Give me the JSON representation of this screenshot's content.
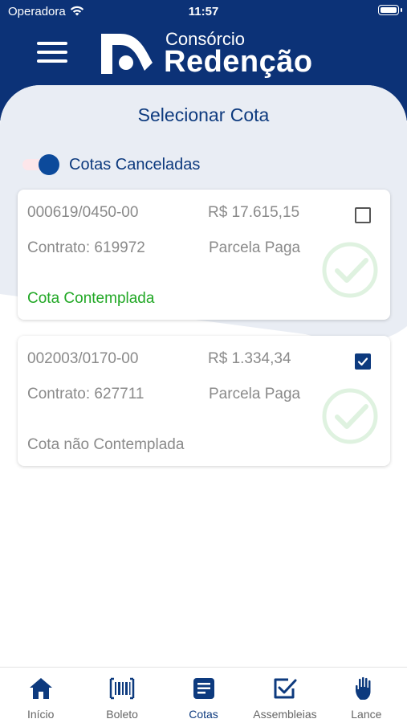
{
  "status_bar": {
    "carrier": "Operadora",
    "time": "11:57"
  },
  "logo": {
    "line1": "Consórcio",
    "line2": "Redenção"
  },
  "page": {
    "title": "Selecionar Cota"
  },
  "filter": {
    "label": "Cotas Canceladas",
    "enabled": true
  },
  "cards": [
    {
      "code": "000619/0450-00",
      "value": "R$ 17.615,15",
      "contract": "Contrato: 619972",
      "parcel_status": "Parcela Paga",
      "quota_status": "Cota Contemplada",
      "selected": false
    },
    {
      "code": "002003/0170-00",
      "value": "R$ 1.334,34",
      "contract": "Contrato: 627711",
      "parcel_status": "Parcela Paga",
      "quota_status": "Cota não Contemplada",
      "selected": true
    }
  ],
  "bottom_nav": [
    {
      "label": "Início",
      "icon": "home-icon"
    },
    {
      "label": "Boleto",
      "icon": "barcode-icon"
    },
    {
      "label": "Cotas",
      "icon": "document-icon",
      "active": true
    },
    {
      "label": "Assembleias",
      "icon": "checkbox-icon"
    },
    {
      "label": "Lance",
      "icon": "hand-icon"
    }
  ],
  "colors": {
    "primary": "#0c3277",
    "accent": "#0d3a7e",
    "success": "#22a826"
  }
}
